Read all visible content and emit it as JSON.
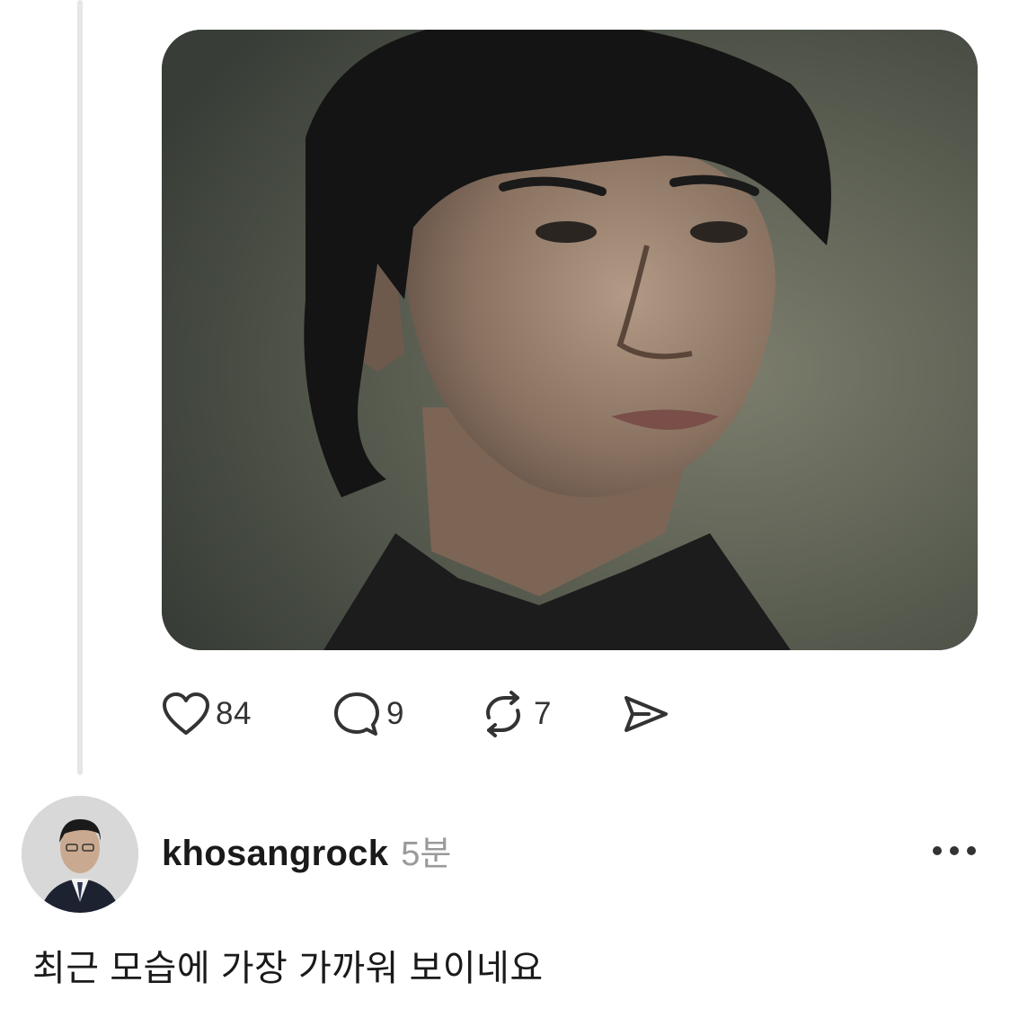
{
  "post": {
    "image_alt": "portrait-photo",
    "actions": {
      "like_count": "84",
      "comment_count": "9",
      "repost_count": "7"
    }
  },
  "reply": {
    "username": "khosangrock",
    "timestamp": "5분",
    "text": "최근 모습에 가장 가까워 보이네요"
  },
  "icons": {
    "like": "heart-icon",
    "comment": "comment-bubble-icon",
    "repost": "repost-icon",
    "share": "send-icon",
    "more": "more-dots-icon"
  },
  "colors": {
    "text_primary": "#1a1a1a",
    "text_secondary": "#9a9a9a",
    "thread_line": "#e6e6e6"
  }
}
